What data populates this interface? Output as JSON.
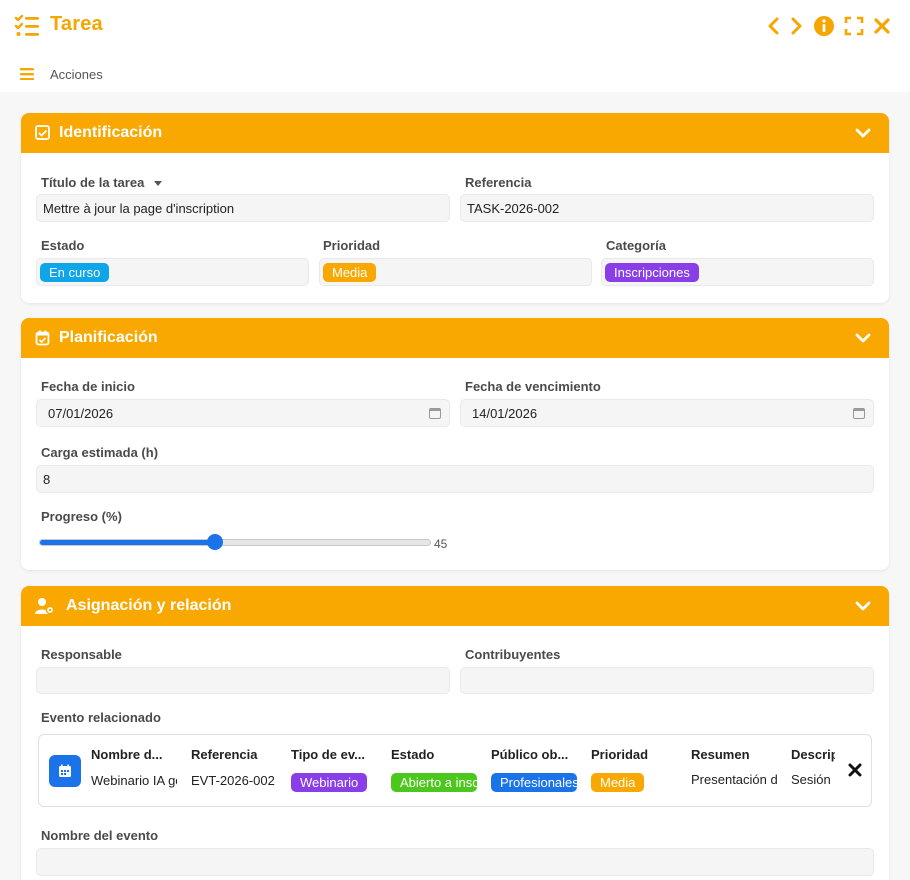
{
  "window": {
    "title": "Tarea"
  },
  "actions": {
    "label": "Acciones"
  },
  "colors": {
    "accent": "#f8a800",
    "blue": "#1a73e8"
  },
  "identificacion": {
    "header": "Identificación",
    "titulo_label": "Título de la tarea",
    "titulo_value": "Mettre à jour la page d'inscription",
    "referencia_label": "Referencia",
    "referencia_value": "TASK-2026-002",
    "estado_label": "Estado",
    "estado_value": "En curso",
    "estado_color": "#0ea5e9",
    "prioridad_label": "Prioridad",
    "prioridad_value": "Media",
    "prioridad_color": "#f8a800",
    "categoria_label": "Categoría",
    "categoria_value": "Inscripciones",
    "categoria_color": "#8a3ee8"
  },
  "planificacion": {
    "header": "Planificación",
    "inicio_label": "Fecha de inicio",
    "inicio_value": "07/01/2026",
    "venc_label": "Fecha de vencimiento",
    "venc_value": "14/01/2026",
    "carga_label": "Carga estimada (h)",
    "carga_value": "8",
    "progreso_label": "Progreso (%)",
    "progreso_value": "45",
    "progreso_fraction": 0.45
  },
  "asignacion": {
    "header": "Asignación y relación",
    "responsable_label": "Responsable",
    "responsable_value": "",
    "contrib_label": "Contribuyentes",
    "contrib_value": "",
    "evento_label": "Evento relacionado",
    "evento": {
      "headers": [
        "Nombre d...",
        "Referencia",
        "Tipo de ev...",
        "Estado",
        "Público ob...",
        "Prioridad",
        "Resumen",
        "Descripción"
      ],
      "values": [
        "Webinario IA generativa",
        "EVT-2026-002",
        "Webinario",
        "Abierto a inscripciones",
        "Profesionales",
        "Media",
        "Presentación de",
        "Sesión"
      ],
      "chip_colors": [
        "",
        "",
        "#8a3ee8",
        "#4cc71e",
        "#1a73e8",
        "#f8a800",
        "",
        ""
      ]
    },
    "nombre_evento_label": "Nombre del evento",
    "nombre_evento_value": ""
  }
}
